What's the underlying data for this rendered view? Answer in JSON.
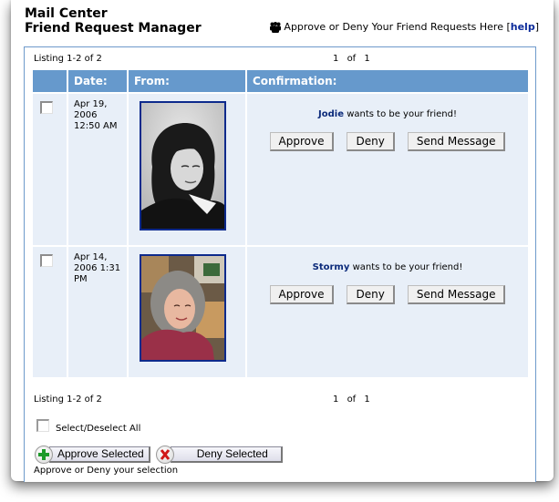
{
  "header": {
    "title_line1": "Mail Center",
    "title_line2": "Friend Request Manager",
    "tagline": "Approve or Deny Your Friend Requests Here",
    "help_open": "[",
    "help_label": "help",
    "help_close": "]",
    "tagline_icon": "friends-icon"
  },
  "pagination_top": {
    "listing": "Listing 1-2 of 2",
    "page": "1",
    "of": "of",
    "total": "1"
  },
  "table": {
    "columns": [
      "",
      "Date:",
      "From:",
      "Confirmation:"
    ],
    "rows": [
      {
        "checked": false,
        "date_line1": "Apr 19,",
        "date_line2": "2006",
        "date_line3": "12:50 AM",
        "from_photo": "black-and-white portrait photo",
        "name": "Jodie",
        "message": "wants to be your friend!",
        "approve_label": "Approve",
        "deny_label": "Deny",
        "send_message_label": "Send Message"
      },
      {
        "checked": false,
        "date_line1": "Apr 14,",
        "date_line2": "2006 1:31",
        "date_line3": "PM",
        "from_photo": "color portrait photo",
        "name": "Stormy",
        "message": "wants to be your friend!",
        "approve_label": "Approve",
        "deny_label": "Deny",
        "send_message_label": "Send Message"
      }
    ]
  },
  "pagination_bottom": {
    "listing": "Listing 1-2 of 2",
    "page": "1",
    "of": "of",
    "total": "1"
  },
  "bulk": {
    "select_all_label": "Select/Deselect All",
    "select_all_checked": false,
    "approve_selected_label": "Approve Selected",
    "deny_selected_label": "Deny Selected",
    "note": "Approve or Deny your selection"
  },
  "colors": {
    "header_bg": "#6699cc",
    "row_bg": "#e8eff8",
    "panel_border": "#6e9acb",
    "link": "#0b2a9a",
    "photo_border": "#0d2a8c"
  }
}
